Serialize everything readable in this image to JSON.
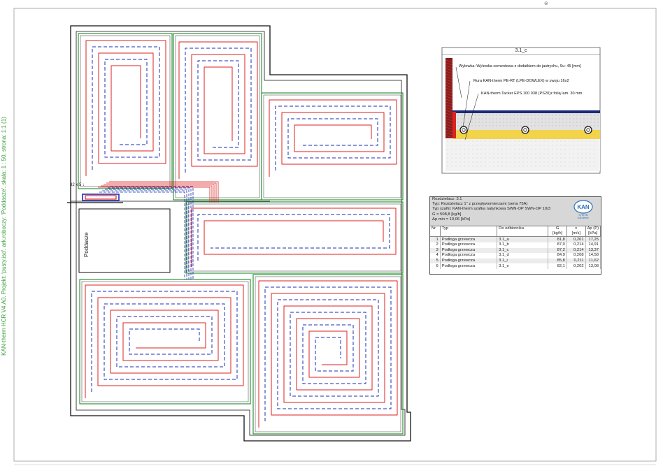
{
  "side_text": "KAN-therm HCR V4.A0. Projekt: 'pusty.isd', ark.roboczy: 'Poddasze', skala: 1 : 50, strona: 1:1 (1)",
  "plan": {
    "room_label": "Poddasze",
    "dimension_label": "32 x 5 ↓",
    "colors": {
      "supply": "#dd2222",
      "return": "#1a2db8",
      "zone": "#1e8a2a",
      "wall": "#111111"
    }
  },
  "detail": {
    "title": "3.1_c",
    "annotations": [
      "Wylewka: Wylewka cementowa z dodatkiem do jastrychu, Su: 45 [mm]",
      "Rura KAN-therm PE-RT (LPE-DOWLEX) w zwoju 16x2",
      "KAN-therm Tacker EPS 100 038 (PS20)z folią lam. 30 mm"
    ]
  },
  "info": {
    "lines": [
      "Rozdzielacz: 3.1",
      "Typ: Rozdzielacz 1\" z przepływomierzami (seria 75A)",
      "Typ szafki: KAN-therm szafka natynkowa SWN-OP SWN-OP 10/3",
      "G = 508,8 [kg/h]",
      "Δp min = 10,06 [kPa]"
    ],
    "logo": {
      "brand": "KAN",
      "sub1": "SYSTEM",
      "sub2": "KAN-therm"
    },
    "columns": [
      "Nr",
      "Typ",
      "Do odbiornika",
      "G",
      "v",
      "Δp (P)"
    ],
    "units": [
      "",
      "",
      "",
      "[kg/h]",
      "[m/s]",
      "[kPa]"
    ],
    "rows": [
      [
        "1",
        "Podłoga grzewcza",
        "3.1_a",
        "81,8",
        "0,201",
        "17,25"
      ],
      [
        "2",
        "Podłoga grzewcza",
        "3.1_b",
        "87,0",
        "0,214",
        "14,91"
      ],
      [
        "3",
        "Podłoga grzewcza",
        "3.1_c",
        "87,2",
        "0,214",
        "13,37"
      ],
      [
        "4",
        "Podłoga grzewcza",
        "3.1_d",
        "84,9",
        "0,208",
        "14,58"
      ],
      [
        "5",
        "Podłoga grzewcza",
        "3.1_i",
        "85,8",
        "0,211",
        "11,62"
      ],
      [
        "6",
        "Podłoga grzewcza",
        "3.1_e",
        "82,1",
        "0,202",
        "13,08"
      ]
    ]
  }
}
